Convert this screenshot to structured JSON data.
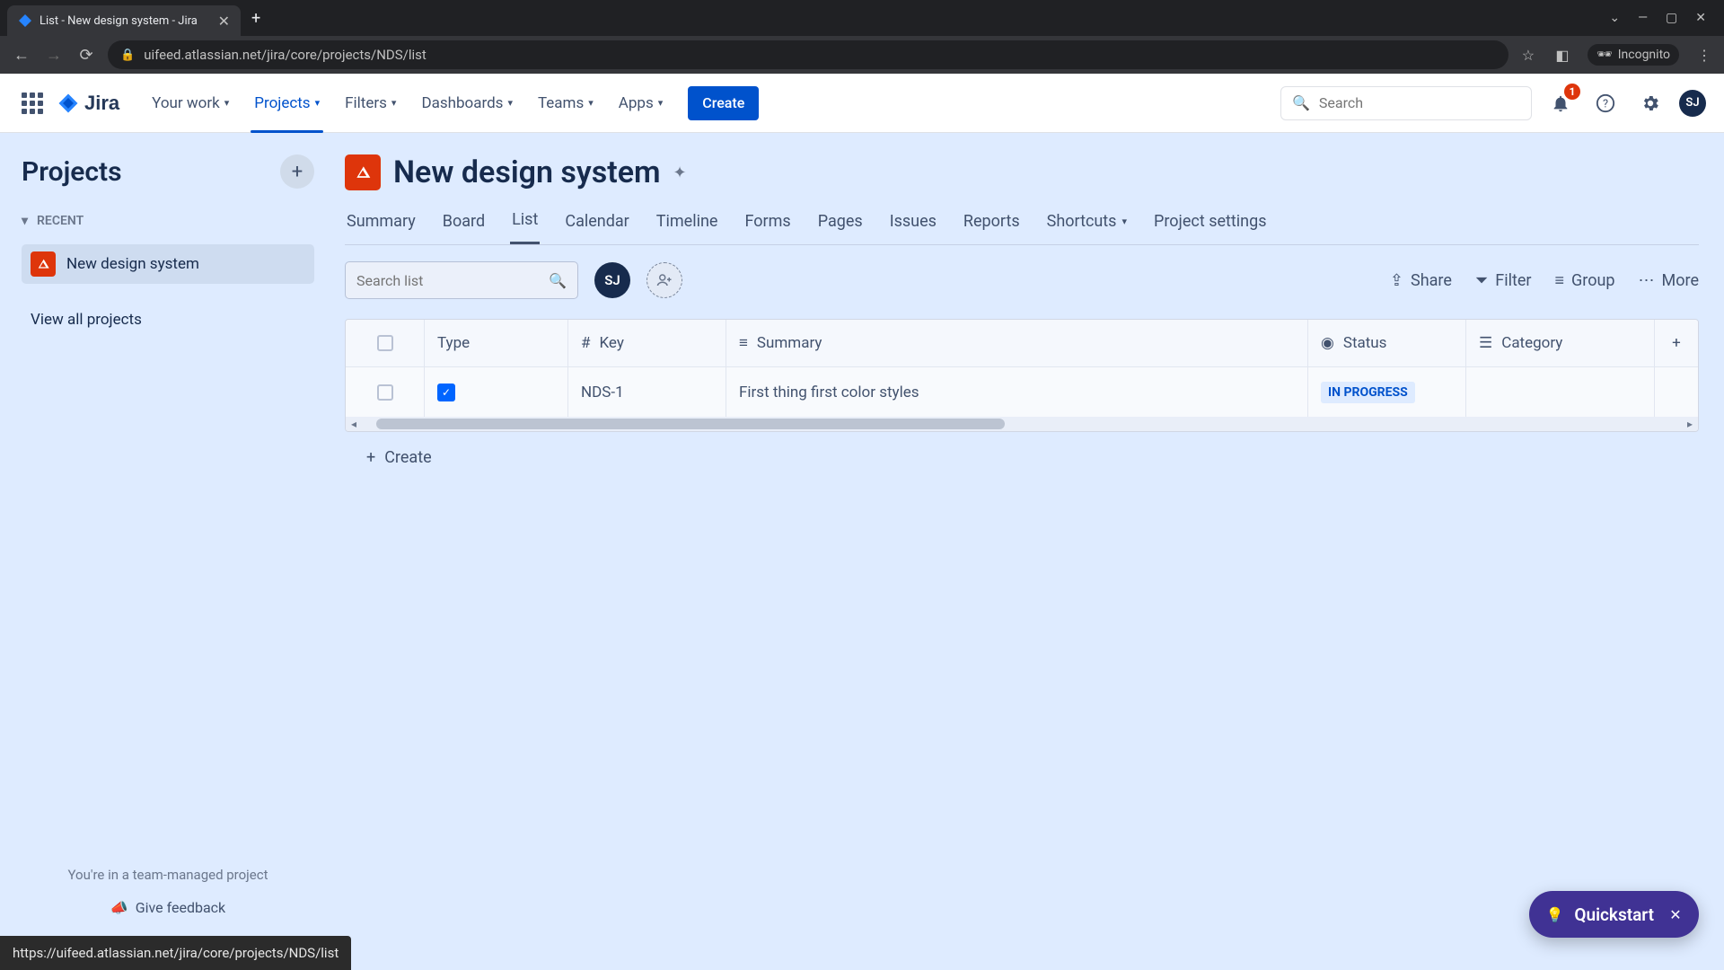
{
  "browser": {
    "tab_title": "List - New design system - Jira",
    "url": "uifeed.atlassian.net/jira/core/projects/NDS/list",
    "incognito_label": "Incognito",
    "status_url": "https://uifeed.atlassian.net/jira/core/projects/NDS/list"
  },
  "nav": {
    "product": "Jira",
    "items": [
      "Your work",
      "Projects",
      "Filters",
      "Dashboards",
      "Teams",
      "Apps"
    ],
    "active_index": 1,
    "create_label": "Create",
    "search_placeholder": "Search",
    "notification_count": "1",
    "avatar_initials": "SJ"
  },
  "sidebar": {
    "title": "Projects",
    "recent_label": "RECENT",
    "current_project": "New design system",
    "view_all": "View all projects",
    "team_managed_text": "You're in a team-managed project",
    "give_feedback": "Give feedback"
  },
  "page": {
    "title": "New design system",
    "tabs": [
      "Summary",
      "Board",
      "List",
      "Calendar",
      "Timeline",
      "Forms",
      "Pages",
      "Issues",
      "Reports",
      "Shortcuts",
      "Project settings"
    ],
    "active_tab_index": 2
  },
  "toolbar": {
    "search_placeholder": "Search list",
    "avatar_initials": "SJ",
    "share": "Share",
    "filter": "Filter",
    "group": "Group",
    "more": "More"
  },
  "table": {
    "columns": {
      "type": "Type",
      "key": "Key",
      "summary": "Summary",
      "status": "Status",
      "category": "Category"
    },
    "rows": [
      {
        "key": "NDS-1",
        "summary": "First thing first color styles",
        "status": "IN PROGRESS"
      }
    ],
    "create_label": "Create"
  },
  "quickstart": {
    "label": "Quickstart"
  }
}
